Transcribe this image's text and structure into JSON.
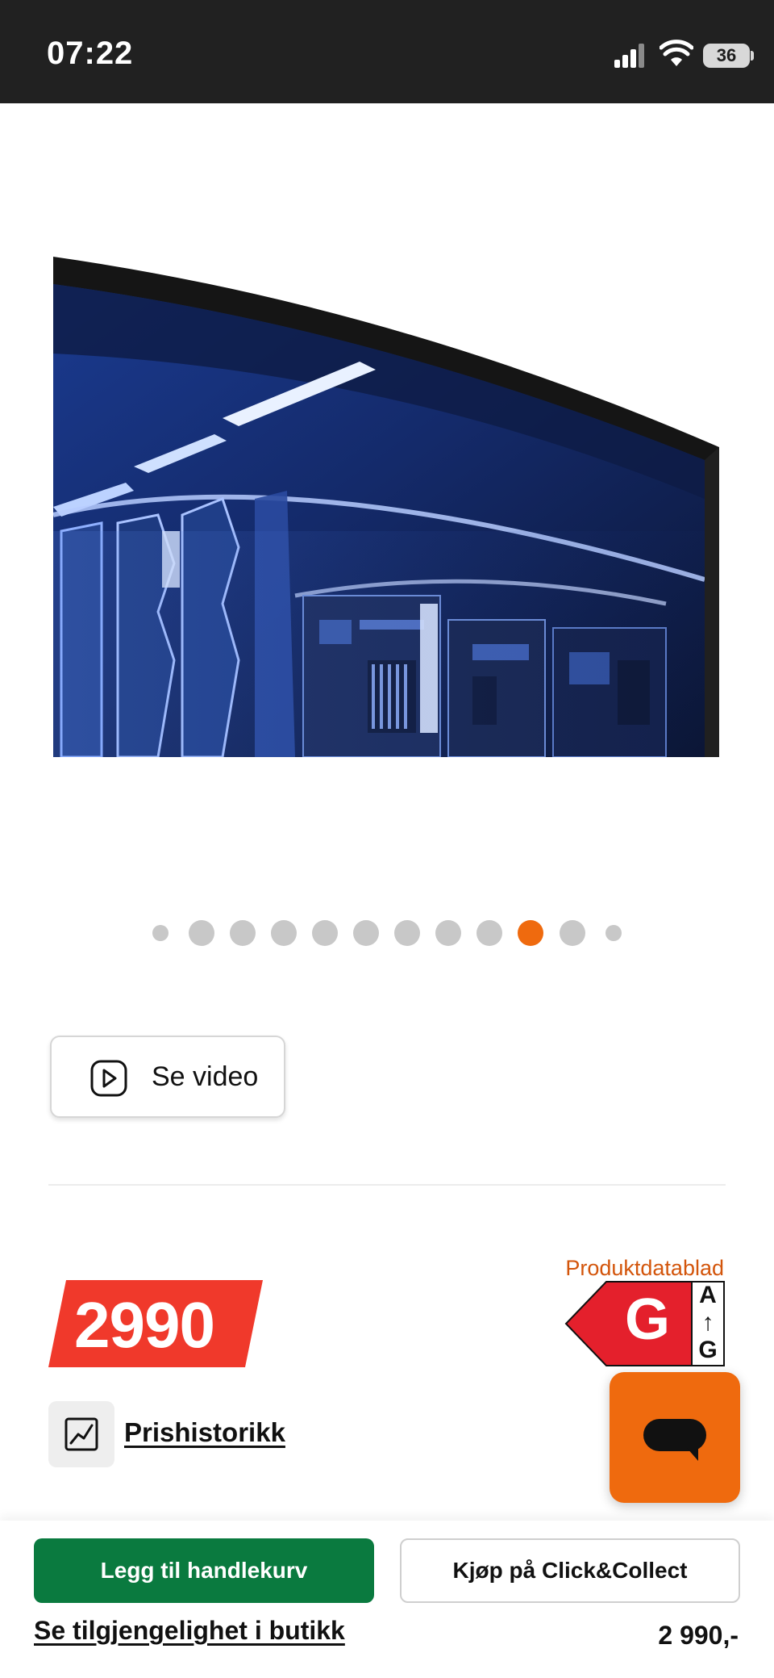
{
  "status_bar": {
    "time": "07:22",
    "battery": "36"
  },
  "product": {
    "image_icon": "curved-monitor-image"
  },
  "carousel": {
    "total": 12,
    "active_index": 9,
    "active_color": "#ef6a0e",
    "inactive_color": "#c8c8c8"
  },
  "video": {
    "label": "Se video",
    "icon": "play-icon"
  },
  "price": {
    "amount": "2990",
    "tag_color": "#f0392b"
  },
  "energy": {
    "datasheet_label": "Produktdatablad",
    "grade": "G",
    "scale_top": "A",
    "scale_arrow": "↑",
    "scale_bottom": "G",
    "color": "#e4202c"
  },
  "price_history": {
    "label": "Prishistorikk",
    "icon": "chart-icon"
  },
  "chat": {
    "icon": "chat-bubble-icon",
    "color": "#ef6a0e"
  },
  "bottom_bar": {
    "add_to_cart": "Legg til handlekurv",
    "click_collect": "Kjøp på Click&Collect",
    "availability": "Se tilgjengelighet i butikk",
    "price": "2 990,-",
    "primary_color": "#0a7a3f"
  }
}
